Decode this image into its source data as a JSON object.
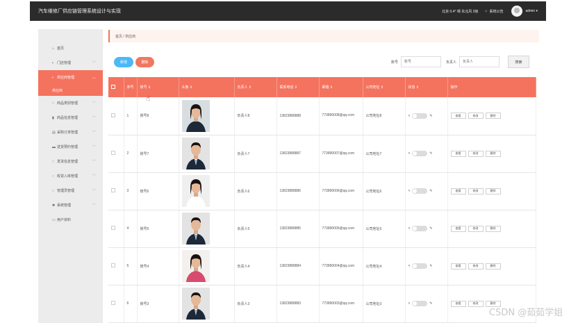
{
  "app": {
    "title": "汽车维修厂供应链管理系统设计与实现"
  },
  "topbar": {
    "weather": "北京 0.4° 晴 东北风 2级",
    "notice_label": "系统公告",
    "user_label": "admin ▾"
  },
  "sidebar": {
    "items": [
      {
        "icon": "⌂",
        "label": "首页"
      },
      {
        "icon": "▪",
        "label": "门店管理"
      },
      {
        "icon": "▪",
        "label": "供应商管理"
      },
      {
        "icon": "∷",
        "label": "商品类别管理"
      },
      {
        "icon": "▮",
        "label": "商品信息管理"
      },
      {
        "icon": "▤",
        "label": "采购订单管理"
      },
      {
        "icon": "▬",
        "label": "送货预约管理"
      },
      {
        "icon": "∷",
        "label": "发货信息管理"
      },
      {
        "icon": "∷",
        "label": "收货入库管理"
      },
      {
        "icon": "∷",
        "label": "管理员管理"
      },
      {
        "icon": "✱",
        "label": "系统管理"
      },
      {
        "icon": "▭",
        "label": "用户资料"
      }
    ],
    "active_sub": "供应商"
  },
  "breadcrumb": "首页 / 供应商",
  "toolbar": {
    "add_label": "新增",
    "delete_label": "删除"
  },
  "search": {
    "account_label": "账号",
    "account_placeholder": "账号",
    "manager_label": "负责人",
    "manager_placeholder": "负责人",
    "search_label": "搜索"
  },
  "table": {
    "headers": [
      "",
      "序号",
      "账号 ⇕",
      "头像 ⇕",
      "负责人 ⇕",
      "联系电话 ⇕",
      "邮箱 ⇕",
      "公司地址 ⇕",
      "状态 ⇕",
      "操作"
    ],
    "rows": [
      {
        "index": "1",
        "account": "账号8",
        "manager": "负责人8",
        "phone": "13823888888",
        "email": "773890008@qq.com",
        "address": "公司地址8",
        "photo": "female-dark"
      },
      {
        "index": "2",
        "account": "账号7",
        "manager": "负责人7",
        "phone": "13823888887",
        "email": "773890007@qq.com",
        "address": "公司地址7",
        "photo": "male-suit"
      },
      {
        "index": "3",
        "account": "账号6",
        "manager": "负责人6",
        "phone": "13823888886",
        "email": "773890006@qq.com",
        "address": "公司地址6",
        "photo": "female-light"
      },
      {
        "index": "4",
        "account": "账号5",
        "manager": "负责人5",
        "phone": "13823888885",
        "email": "773890005@qq.com",
        "address": "公司地址5",
        "photo": "male-suit"
      },
      {
        "index": "5",
        "account": "账号4",
        "manager": "负责人4",
        "phone": "13823888884",
        "email": "773890004@qq.com",
        "address": "公司地址4",
        "photo": "female-pink"
      },
      {
        "index": "6",
        "account": "账号3",
        "manager": "负责人3",
        "phone": "13823888883",
        "email": "773890003@qq.com",
        "address": "公司地址3",
        "photo": "male-suit"
      }
    ],
    "ops": [
      "查看",
      "修改",
      "删除"
    ]
  },
  "watermark": "CSDN @茹茹学姐",
  "colors": {
    "accent": "#f4735f",
    "add": "#4db8f5",
    "topbar": "#2b2b2b"
  }
}
